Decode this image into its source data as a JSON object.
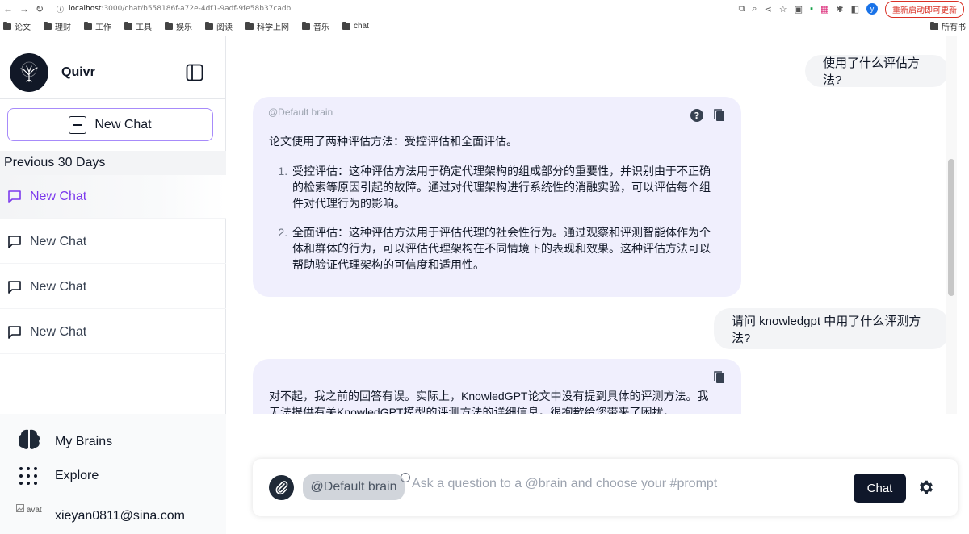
{
  "browser": {
    "url_host": "localhost",
    "url_path": ":3000/chat/b558186f-a72e-4df1-9adf-9fe58b37cadb",
    "update_button": "重新启动即可更新",
    "profile_letter": "y",
    "bookmarks": [
      "论文",
      "理财",
      "工作",
      "工具",
      "娱乐",
      "阅读",
      "科学上网",
      "音乐",
      "chat"
    ],
    "all_bookmarks": "所有书"
  },
  "sidebar": {
    "brand": "Quivr",
    "new_chat": "New Chat",
    "section": "Previous 30 Days",
    "chats": [
      "New Chat",
      "New Chat",
      "New Chat",
      "New Chat"
    ],
    "my_brains": "My Brains",
    "explore": "Explore",
    "user_email": "xieyan0811@sina.com",
    "avatar_alt": "avat"
  },
  "messages": {
    "user1": "使用了什么评估方法?",
    "bot1_brain": "@Default brain",
    "bot1_intro": "论文使用了两种评估方法：受控评估和全面评估。",
    "bot1_items": [
      "受控评估：这种评估方法用于确定代理架构的组成部分的重要性，并识别由于不正确的检索等原因引起的故障。通过对代理架构进行系统性的消融实验，可以评估每个组件对代理行为的影响。",
      "全面评估：这种评估方法用于评估代理的社会性行为。通过观察和评测智能体作为个体和群体的行为，可以评估代理架构在不同情境下的表现和效果。这种评估方法可以帮助验证代理架构的可信度和适用性。"
    ],
    "user2": "请问 knowledgpt 中用了什么评测方法?",
    "bot2_text": "对不起，我之前的回答有误。实际上，KnowledGPT论文中没有提到具体的评测方法。我无法提供有关KnowledGPT模型的评测方法的详细信息。很抱歉给您带来了困扰。"
  },
  "composer": {
    "brain_chip": "@Default brain",
    "placeholder": "Ask a question to a @brain and choose your #prompt",
    "send": "Chat"
  },
  "icons": {
    "help": "question-circle-icon",
    "copy": "copy-icon",
    "attach": "paperclip-icon",
    "settings": "gear-icon",
    "collapse": "sidebar-toggle-icon",
    "brain": "brain-icon",
    "explore": "grid-dots-icon"
  },
  "colors": {
    "accent": "#7c3aed",
    "bot_bubble": "#f0effd",
    "dark": "#0f172a"
  }
}
